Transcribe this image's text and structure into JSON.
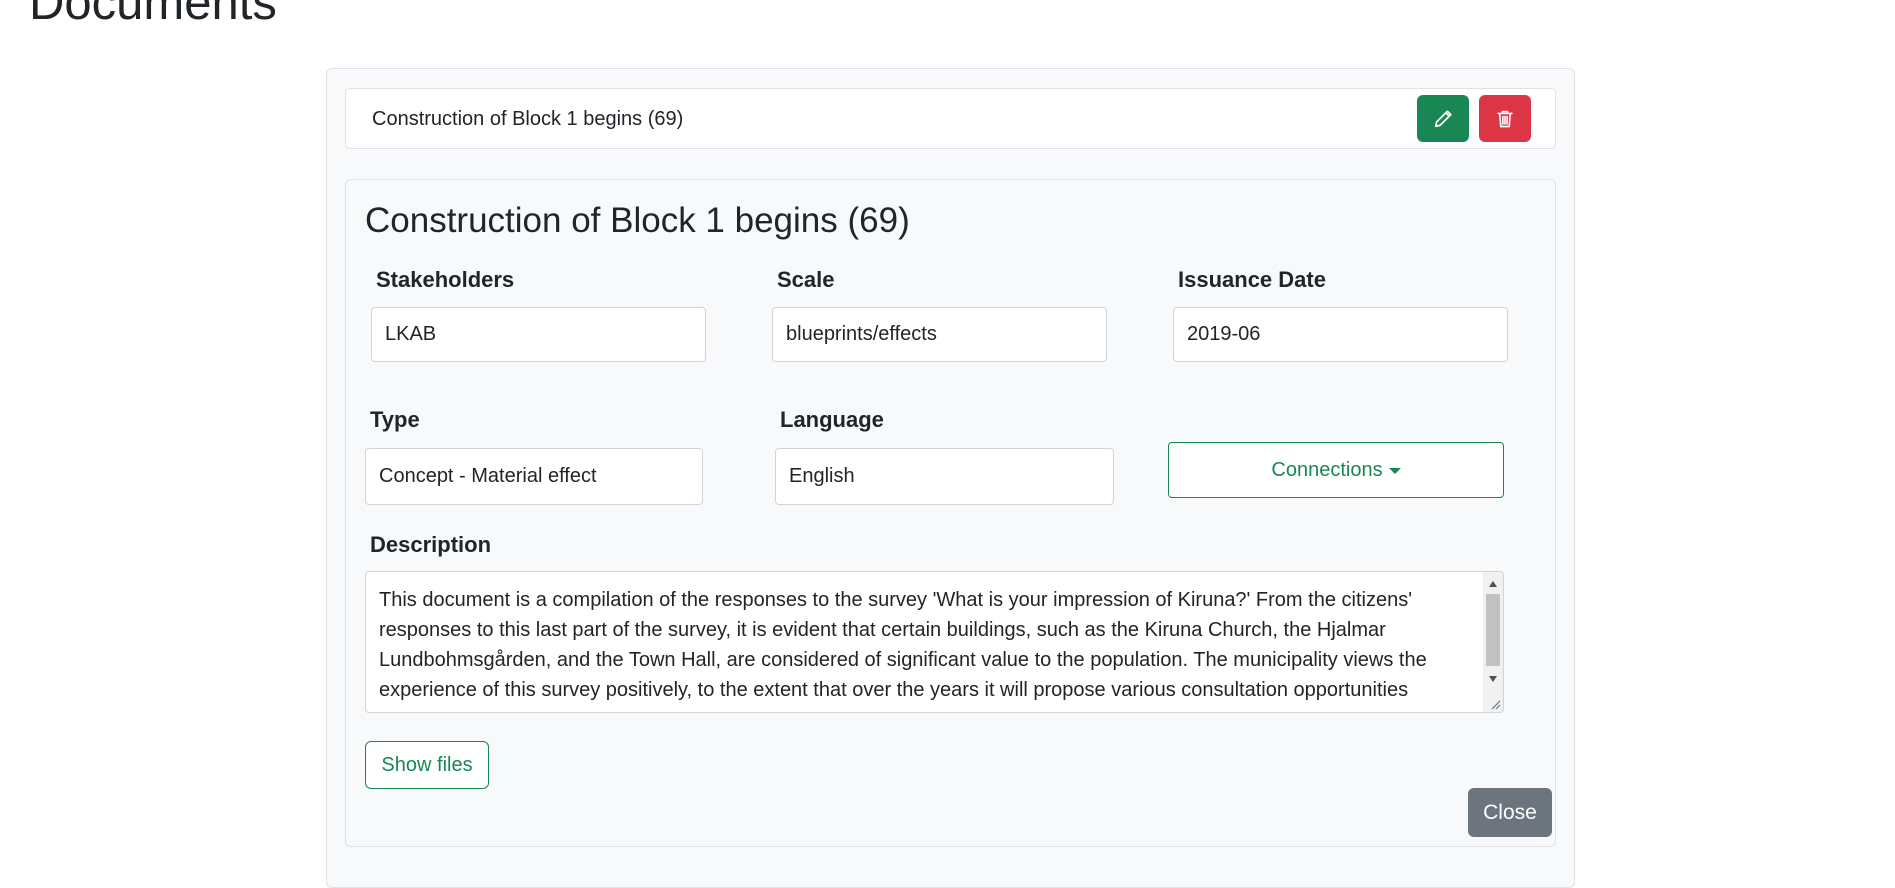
{
  "page": {
    "title": "Documents"
  },
  "document_row": {
    "title": "Construction of Block 1 begins (69)",
    "edit_icon": "pencil-icon",
    "delete_icon": "trash-icon"
  },
  "detail": {
    "title": "Construction of Block 1 begins (69)",
    "fields": {
      "stakeholders": {
        "label": "Stakeholders",
        "value": "LKAB"
      },
      "scale": {
        "label": "Scale",
        "value": "blueprints/effects"
      },
      "issuance_date": {
        "label": "Issuance Date",
        "value": "2019-06"
      },
      "type": {
        "label": "Type",
        "value": "Concept - Material effect"
      },
      "language": {
        "label": "Language",
        "value": "English"
      }
    },
    "connections_label": "Connections",
    "description": {
      "label": "Description",
      "text": "This document is a compilation of the responses to the survey 'What is your impression of Kiruna?' From the citizens' responses to this last part of the survey, it is evident that certain buildings, such as the Kiruna Church, the Hjalmar Lundbohmsgården, and the Town Hall, are considered of significant value to the population. The municipality views the experience of this survey positively, to the extent that over the years it will propose various consultation opportunities"
    },
    "show_files_label": "Show files",
    "close_label": "Close"
  },
  "colors": {
    "success": "#198754",
    "danger": "#dc3545",
    "secondary": "#6c757d",
    "card_bg": "#f8f9fa"
  }
}
